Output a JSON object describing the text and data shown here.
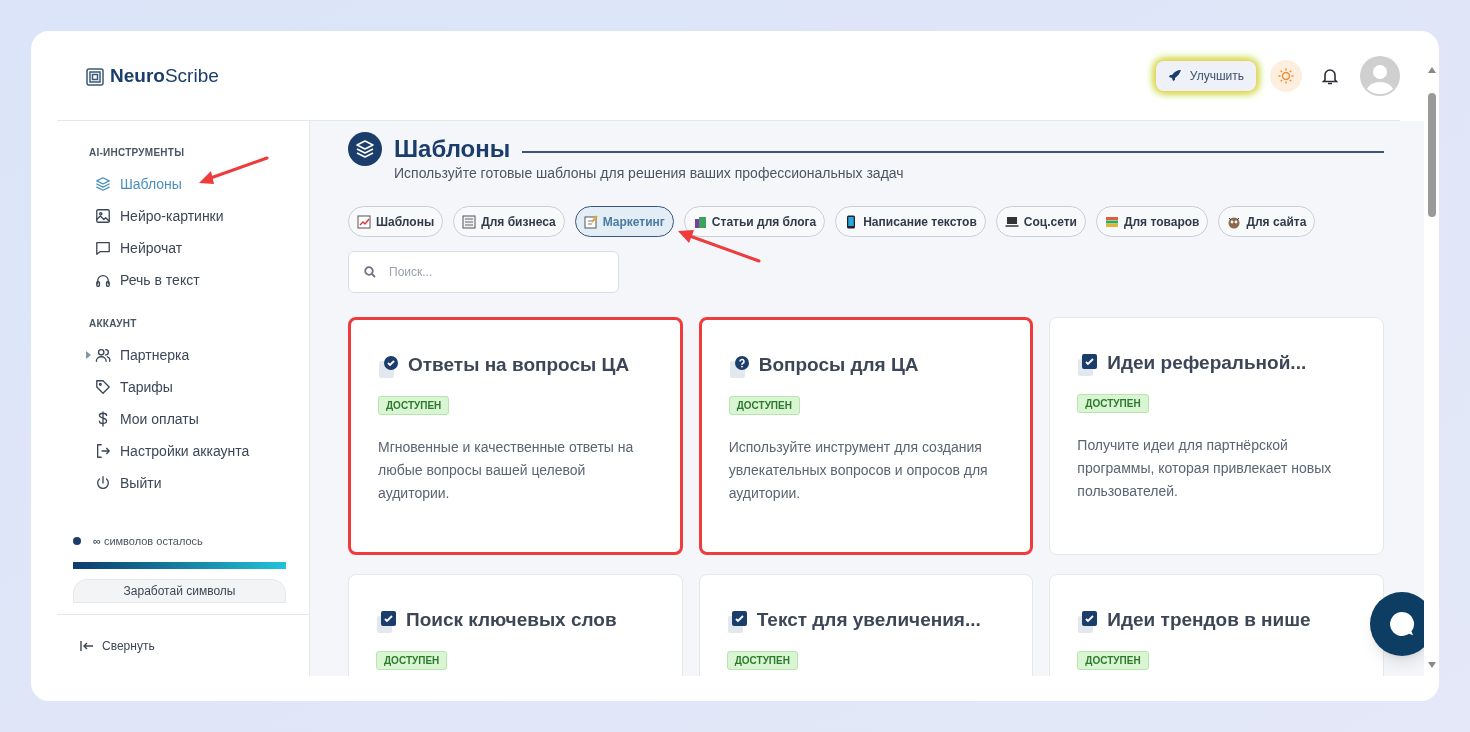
{
  "logo": {
    "bold": "Neuro",
    "light": "Scribe"
  },
  "header": {
    "upgrade_button": "Улучшить"
  },
  "sidebar": {
    "sections": [
      {
        "title": "AI-ИНСТРУМЕНТЫ",
        "items": [
          {
            "label": "Шаблоны",
            "kind": "layers",
            "selected": true,
            "expandable": false
          },
          {
            "label": "Нейро-картинки",
            "kind": "image",
            "selected": false,
            "expandable": false
          },
          {
            "label": "Нейрочат",
            "kind": "chat",
            "selected": false,
            "expandable": false
          },
          {
            "label": "Речь в текст",
            "kind": "headphones",
            "selected": false,
            "expandable": false
          }
        ]
      },
      {
        "title": "АККАУНТ",
        "items": [
          {
            "label": "Партнерка",
            "kind": "users",
            "selected": false,
            "expandable": true
          },
          {
            "label": "Тарифы",
            "kind": "tag",
            "selected": false,
            "expandable": false
          },
          {
            "label": "Мои оплаты",
            "kind": "dollar",
            "selected": false,
            "expandable": false
          },
          {
            "label": "Настройки аккаунта",
            "kind": "logout",
            "selected": false,
            "expandable": false
          },
          {
            "label": "Выйти",
            "kind": "power",
            "selected": false,
            "expandable": false
          }
        ]
      }
    ],
    "symbols": {
      "text": "**∞** символов осталось",
      "level": 1
    },
    "earn_button": "Заработай символы",
    "collapse": "Свернуть"
  },
  "page": {
    "title": "Шаблоны",
    "subtitle": "Используйте готовые шаблоны для решения ваших профессиональных задач"
  },
  "chips": [
    {
      "label": "Шаблоны",
      "kind": "chart",
      "selected": false
    },
    {
      "label": "Для бизнеса",
      "kind": "doc",
      "selected": false
    },
    {
      "label": "Маркетинг",
      "kind": "memo",
      "selected": true
    },
    {
      "label": "Статьи для блога",
      "kind": "bag",
      "selected": false
    },
    {
      "label": "Написание текстов",
      "kind": "phone",
      "selected": false
    },
    {
      "label": "Соц.сети",
      "kind": "laptop",
      "selected": false
    },
    {
      "label": "Для товаров",
      "kind": "books",
      "selected": false
    },
    {
      "label": "Для сайта",
      "kind": "face",
      "selected": false
    }
  ],
  "search": {
    "placeholder": "Поиск..."
  },
  "cards": [
    {
      "title": "Ответы на вопросы ЦА",
      "kind": "check-circle",
      "badge": "ДОСТУПЕН",
      "description": "Мгновенные и качественные ответы на любые вопросы вашей целевой аудитории.",
      "highlighted": true
    },
    {
      "title": "Вопросы для ЦА",
      "kind": "question",
      "badge": "ДОСТУПЕН",
      "description": "Используйте инструмент для создания увлекательных вопросов и опросов для аудитории.",
      "highlighted": true
    },
    {
      "title": "Идеи реферальной...",
      "kind": "check-box",
      "badge": "ДОСТУПЕН",
      "description": "Получите идеи для партнёрской программы, которая привлекает новых пользователей.",
      "highlighted": false
    },
    {
      "title": "Поиск ключевых слов",
      "kind": "check-box",
      "badge": "ДОСТУПЕН",
      "highlighted": false
    },
    {
      "title": "Текст для увеличения...",
      "kind": "check-box",
      "badge": "ДОСТУПЕН",
      "highlighted": false
    },
    {
      "title": "Идеи трендов в нише",
      "kind": "check-box",
      "badge": "ДОСТУПЕН",
      "highlighted": false
    }
  ]
}
